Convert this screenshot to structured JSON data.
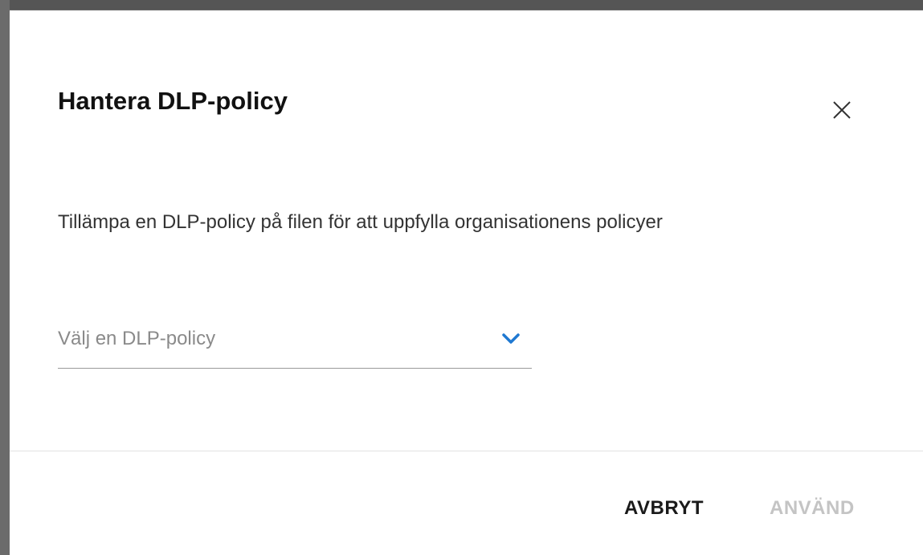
{
  "dialog": {
    "title": "Hantera DLP-policy",
    "close_icon": "close-icon",
    "description": "Tillämpa en DLP-policy på filen för att uppfylla organisationens policyer",
    "select": {
      "placeholder": "Välj en DLP-policy",
      "chevron_icon": "chevron-down-icon",
      "accent_color": "#1f78d1"
    },
    "buttons": {
      "cancel_label": "AVBRYT",
      "apply_label": "ANVÄND",
      "apply_disabled": true
    }
  }
}
